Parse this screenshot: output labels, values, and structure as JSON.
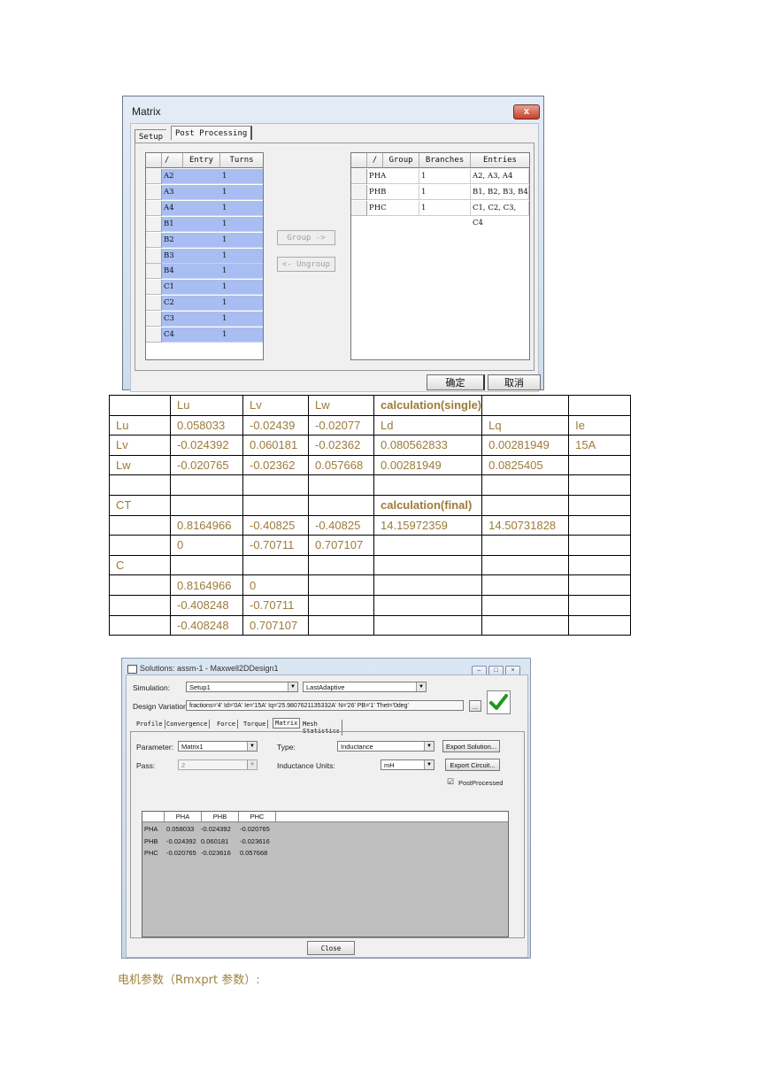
{
  "matrix_dialog": {
    "title": "Matrix",
    "close_glyph": "x",
    "tabs": [
      "Setup",
      "Post Processing"
    ],
    "entry_grid": {
      "headers": [
        "/",
        "Entry",
        "Turns"
      ],
      "rows": [
        {
          "entry": "A2",
          "turns": "1"
        },
        {
          "entry": "A3",
          "turns": "1"
        },
        {
          "entry": "A4",
          "turns": "1"
        },
        {
          "entry": "B1",
          "turns": "1"
        },
        {
          "entry": "B2",
          "turns": "1"
        },
        {
          "entry": "B3",
          "turns": "1"
        },
        {
          "entry": "B4",
          "turns": "1"
        },
        {
          "entry": "C1",
          "turns": "1"
        },
        {
          "entry": "C2",
          "turns": "1"
        },
        {
          "entry": "C3",
          "turns": "1"
        },
        {
          "entry": "C4",
          "turns": "1"
        }
      ]
    },
    "group_button": "Group ->",
    "ungroup_button": "<- Ungroup",
    "group_grid": {
      "headers": [
        "/",
        "Group",
        "Branches",
        "Entries"
      ],
      "rows": [
        {
          "group": "PHA",
          "branches": "1",
          "entries": "A2, A3, A4"
        },
        {
          "group": "PHB",
          "branches": "1",
          "entries": "B1, B2, B3, B4"
        },
        {
          "group": "PHC",
          "branches": "1",
          "entries": "C1, C2, C3, C4"
        }
      ]
    },
    "ok_button": "确定",
    "cancel_button": "取消"
  },
  "data_table": {
    "rows": [
      [
        "",
        "Lu",
        "Lv",
        "Lw",
        "calculation(single)",
        "",
        ""
      ],
      [
        "Lu",
        "0.058033",
        "-0.02439",
        "-0.02077",
        "Ld",
        "Lq",
        "Ie"
      ],
      [
        "Lv",
        "-0.024392",
        "0.060181",
        "-0.02362",
        "0.080562833",
        "0.00281949",
        "15A"
      ],
      [
        "Lw",
        "-0.020765",
        "-0.02362",
        "0.057668",
        "0.00281949",
        "0.0825405",
        ""
      ],
      [
        "",
        "",
        "",
        "",
        "",
        "",
        ""
      ],
      [
        "CT",
        "",
        "",
        "",
        "calculation(final)",
        "",
        ""
      ],
      [
        "",
        "0.8164966",
        "-0.40825",
        "-0.40825",
        "14.15972359",
        "14.50731828",
        ""
      ],
      [
        "",
        "0",
        "-0.70711",
        "0.707107",
        "",
        "",
        ""
      ],
      [
        "C",
        "",
        "",
        "",
        "",
        "",
        ""
      ],
      [
        "",
        "0.8164966",
        "0",
        "",
        "",
        "",
        ""
      ],
      [
        "",
        "-0.408248",
        "-0.70711",
        "",
        "",
        "",
        ""
      ],
      [
        "",
        "-0.408248",
        "0.707107",
        "",
        "",
        "",
        ""
      ]
    ]
  },
  "solutions_window": {
    "title": "Solutions: assm-1 - Maxwell2DDesign1",
    "simulation_label": "Simulation:",
    "simulation_value": "Setup1",
    "adaptive_value": "LastAdaptive",
    "design_variation_label": "Design Variation:",
    "design_variation_value": "fractions='4' Id='0A' Ie='15A' Iq='25.9807621135332A' N='26' PB='1' Thet='0deg'",
    "browse_button": "...",
    "tabs": [
      "Profile",
      "Convergence",
      "Force",
      "Torque",
      "Matrix",
      "Mesh Statistics"
    ],
    "parameter_label": "Parameter:",
    "parameter_value": "Matrix1",
    "type_label": "Type:",
    "type_value": "Inductance",
    "export_solution_button": "Export Solution...",
    "pass_label": "Pass:",
    "pass_value": "2",
    "units_label": "Inductance Units:",
    "units_value": "mH",
    "export_circuit_button": "Export Circuit...",
    "postprocessed_check": "☑",
    "postprocessed_label": "PostProcessed",
    "matrix_headers": [
      "PHA",
      "PHB",
      "PHC"
    ],
    "matrix_rows": [
      {
        "label": "PHA",
        "values": [
          "0.058033",
          "-0.024392",
          "-0.020765"
        ]
      },
      {
        "label": "PHB",
        "values": [
          "-0.024392",
          "0.060181",
          "-0.023616"
        ]
      },
      {
        "label": "PHC",
        "values": [
          "-0.020765",
          "-0.023616",
          "0.057668"
        ]
      }
    ],
    "close_button": "Close"
  },
  "caption": "电机参数（Rmxprt 参数）:"
}
